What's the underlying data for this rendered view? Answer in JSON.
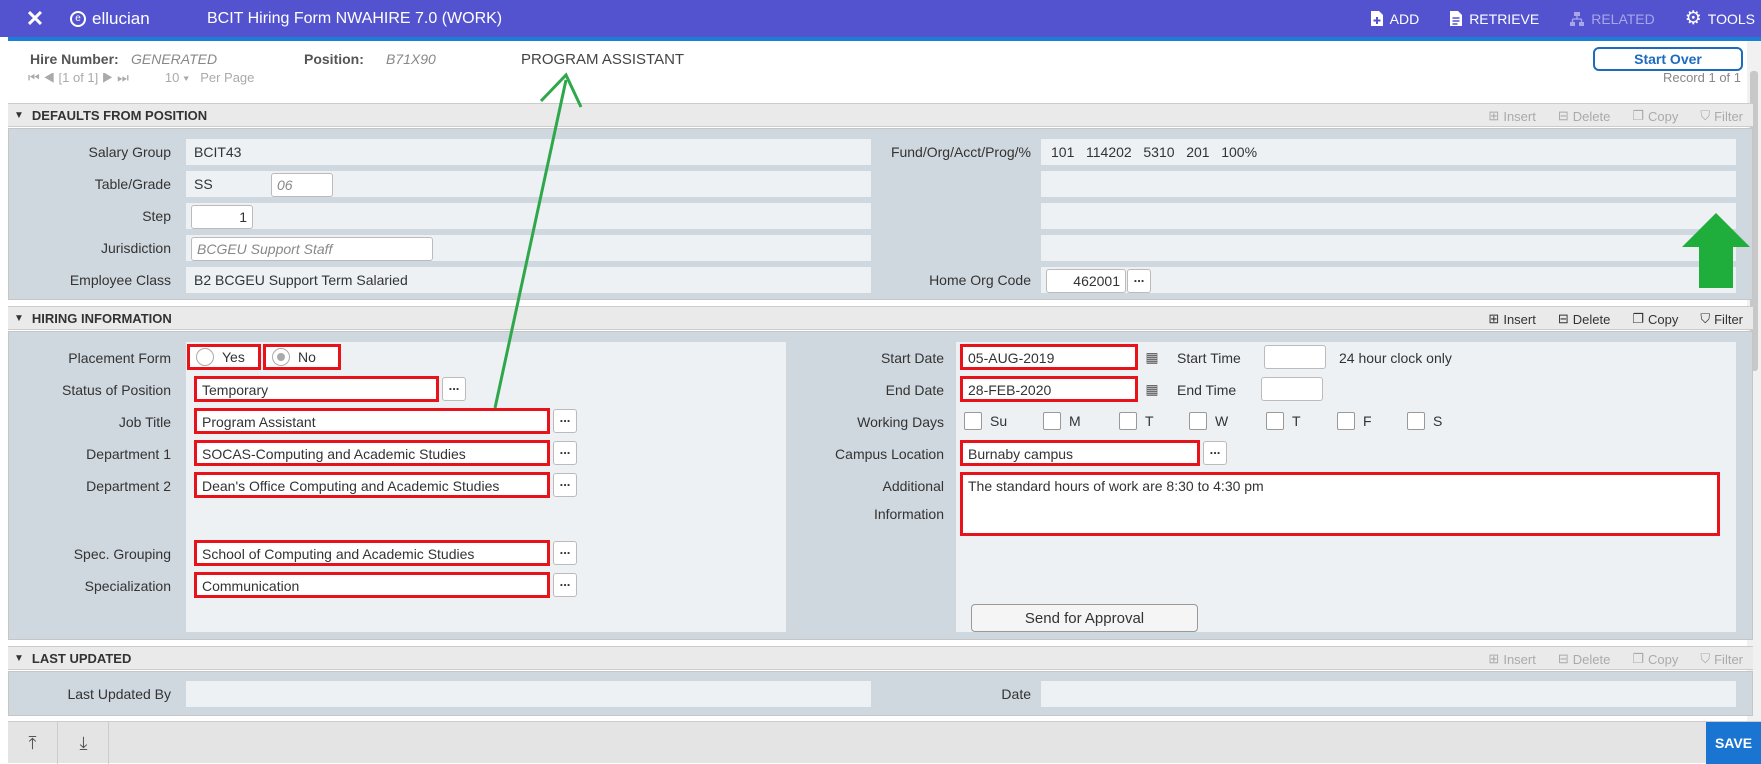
{
  "topbar": {
    "brand": "ellucian",
    "title": "BCIT Hiring Form NWAHIRE 7.0 (WORK)",
    "actions": {
      "add": "ADD",
      "retrieve": "RETRIEVE",
      "related": "RELATED",
      "tools": "TOOLS"
    }
  },
  "keyblock": {
    "hire_label": "Hire Number:",
    "hire_value": "GENERATED",
    "position_label": "Position:",
    "position_code": "B71X90",
    "position_title": "PROGRAM ASSISTANT",
    "start_over": "Start Over"
  },
  "pager": {
    "per_page": "Per Page",
    "record": "Record 1 of 1",
    "page": "1 of 1",
    "size": "10"
  },
  "defaults": {
    "title": "DEFAULTS FROM POSITION",
    "tools": {
      "insert": "Insert",
      "delete": "Delete",
      "copy": "Copy",
      "filter": "Filter"
    },
    "salary_group_label": "Salary Group",
    "salary_group": "BCIT43",
    "table_grade_label": "Table/Grade",
    "table": "SS",
    "grade": "06",
    "step_label": "Step",
    "step": "1",
    "jurisdiction_label": "Jurisdiction",
    "jurisdiction": "BCGEU Support Staff",
    "employee_class_label": "Employee Class",
    "employee_class": "B2  BCGEU Support Term Salaried",
    "fund_label": "Fund/Org/Acct/Prog/%",
    "fund": "101   114202   5310   201   100%",
    "home_org_label": "Home Org Code",
    "home_org": "462001"
  },
  "hiring": {
    "title": "HIRING INFORMATION",
    "tools": {
      "insert": "Insert",
      "delete": "Delete",
      "copy": "Copy",
      "filter": "Filter"
    },
    "placement_label": "Placement Form",
    "yes": "Yes",
    "no": "No",
    "status_label": "Status of Position",
    "status": "Temporary",
    "job_title_label": "Job Title",
    "job_title": "Program Assistant",
    "dept1_label": "Department 1",
    "dept1": "SOCAS-Computing and Academic Studies",
    "dept2_label": "Department 2",
    "dept2": "Dean's Office Computing and Academic Studies",
    "spec_group_label": "Spec. Grouping",
    "spec_group": "School of Computing and Academic Studies",
    "specialization_label": "Specialization",
    "specialization": "Communication",
    "start_date_label": "Start Date",
    "start_date": "05-AUG-2019",
    "start_time_label": "Start Time",
    "clock_note": "24 hour clock only",
    "end_date_label": "End Date",
    "end_date": "28-FEB-2020",
    "end_time_label": "End Time",
    "working_days_label": "Working Days",
    "days": [
      "Su",
      "M",
      "T",
      "W",
      "T",
      "F",
      "S"
    ],
    "campus_label": "Campus Location",
    "campus": "Burnaby campus",
    "additional_label_1": "Additional",
    "additional_label_2": "Information",
    "additional": "The standard hours of work are 8:30 to 4:30 pm",
    "send_approval": "Send for Approval"
  },
  "last_updated": {
    "title": "LAST UPDATED",
    "tools": {
      "insert": "Insert",
      "delete": "Delete",
      "copy": "Copy",
      "filter": "Filter"
    },
    "by_label": "Last Updated By",
    "date_label": "Date"
  },
  "bottom": {
    "save": "SAVE"
  },
  "colors": {
    "topbar": "#5353d0",
    "highlight": "#e8121b",
    "arrow_green": "#2ea84a",
    "save": "#1a75d2"
  }
}
